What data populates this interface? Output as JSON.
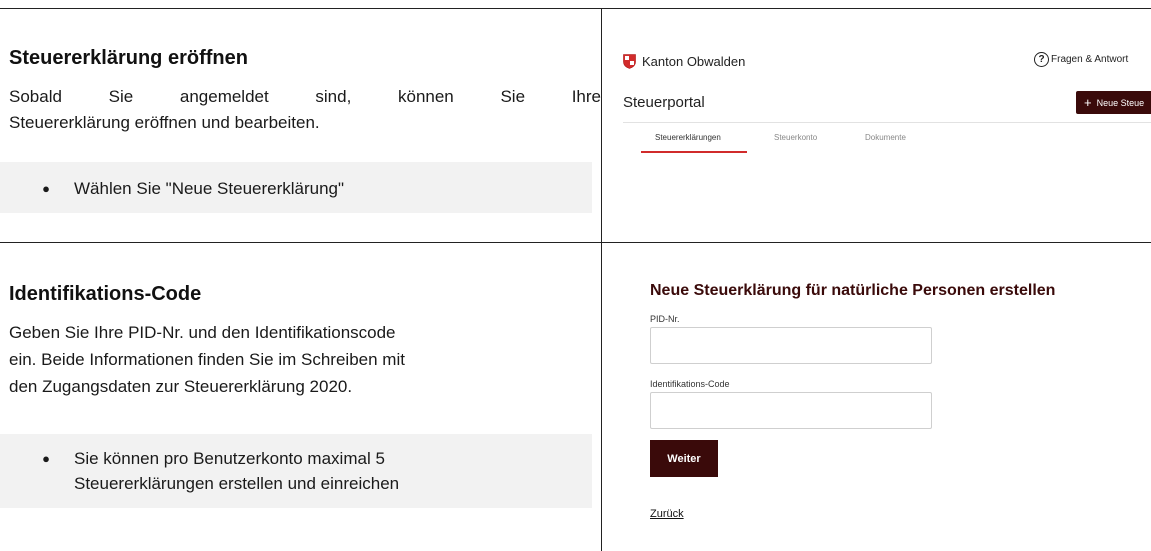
{
  "section1": {
    "title": "Steuererklärung eröffnen",
    "body_line1": "Sobald Sie angemeldet sind, können Sie Ihre",
    "body_line2": "Steuererklärung eröffnen und bearbeiten.",
    "bullet": "Wählen Sie \"Neue Steuererklärung\""
  },
  "section2": {
    "title": "Identifikations-Code",
    "body_line1": "Geben Sie Ihre PID-Nr. und den Identifikationscode",
    "body_line2": "ein. Beide Informationen finden Sie im Schreiben mit",
    "body_line3": "den Zugangsdaten zur Steuererklärung 2020.",
    "bullet_line1": "Sie können pro Benutzerkonto maximal 5",
    "bullet_line2": "Steuererklärungen erstellen und einreichen"
  },
  "portal": {
    "brand": "Kanton Obwalden",
    "help_label": "Fragen & Antwort",
    "title": "Steuerportal",
    "new_button": "Neue Steue",
    "tabs": [
      "Steuererklärungen",
      "Steuerkonto",
      "Dokumente"
    ],
    "accent_color": "#d12b2b",
    "brand_color": "#3a0a0a",
    "icons": {
      "brand": "shield-icon",
      "help": "question-circle-icon",
      "new": "plus-icon"
    }
  },
  "form": {
    "title": "Neue Steuerklärung für natürliche Personen erstellen",
    "pid_label": "PID-Nr.",
    "pid_value": "",
    "code_label": "Identifikations-Code",
    "code_value": "",
    "submit_label": "Weiter",
    "back_label": "Zurück"
  }
}
